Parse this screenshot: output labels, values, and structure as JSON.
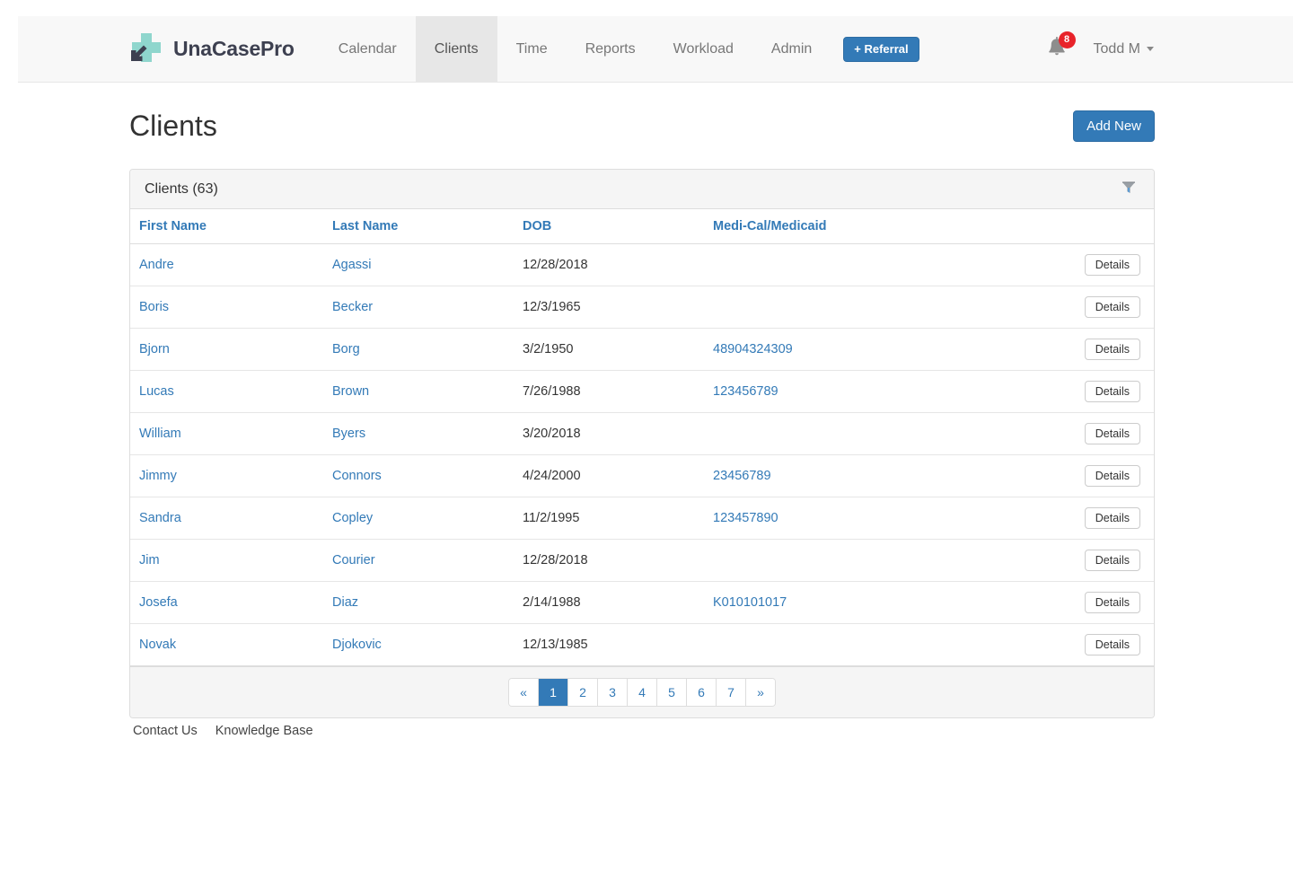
{
  "brand": {
    "name": "UnaCasePro",
    "logo_icon": "cross-arrow-logo",
    "logo_cross_color": "#8fd6cd",
    "logo_arrow_color": "#3d4050"
  },
  "nav": {
    "items": [
      {
        "label": "Calendar",
        "active": false
      },
      {
        "label": "Clients",
        "active": true
      },
      {
        "label": "Time",
        "active": false
      },
      {
        "label": "Reports",
        "active": false
      },
      {
        "label": "Workload",
        "active": false
      },
      {
        "label": "Admin",
        "active": false
      }
    ],
    "referral_button": "+ Referral",
    "notifications": {
      "icon": "bell-icon",
      "count": "8",
      "badge_color": "#e8232a"
    },
    "user": {
      "name": "Todd M",
      "caret_icon": "caret-down-icon"
    }
  },
  "page": {
    "title": "Clients",
    "add_new_button": "Add New",
    "accent_color": "#337ab7"
  },
  "panel": {
    "title": "Clients (63)",
    "filter_icon": "filter-funnel-icon"
  },
  "table": {
    "columns": [
      "First Name",
      "Last Name",
      "DOB",
      "Medi-Cal/Medicaid",
      ""
    ],
    "details_label": "Details",
    "rows": [
      {
        "first": "Andre",
        "last": "Agassi",
        "dob": "12/28/2018",
        "medical": ""
      },
      {
        "first": "Boris",
        "last": "Becker",
        "dob": "12/3/1965",
        "medical": ""
      },
      {
        "first": "Bjorn",
        "last": "Borg",
        "dob": "3/2/1950",
        "medical": "48904324309"
      },
      {
        "first": "Lucas",
        "last": "Brown",
        "dob": "7/26/1988",
        "medical": "123456789"
      },
      {
        "first": "William",
        "last": "Byers",
        "dob": "3/20/2018",
        "medical": ""
      },
      {
        "first": "Jimmy",
        "last": "Connors",
        "dob": "4/24/2000",
        "medical": "23456789"
      },
      {
        "first": "Sandra",
        "last": "Copley",
        "dob": "11/2/1995",
        "medical": "123457890"
      },
      {
        "first": "Jim",
        "last": "Courier",
        "dob": "12/28/2018",
        "medical": ""
      },
      {
        "first": "Josefa",
        "last": "Diaz",
        "dob": "2/14/1988",
        "medical": "K010101017"
      },
      {
        "first": "Novak",
        "last": "Djokovic",
        "dob": "12/13/1985",
        "medical": ""
      }
    ]
  },
  "pagination": {
    "prev": "«",
    "next": "»",
    "pages": [
      "1",
      "2",
      "3",
      "4",
      "5",
      "6",
      "7"
    ],
    "current": "1"
  },
  "footer": {
    "links": [
      "Contact Us",
      "Knowledge Base"
    ]
  }
}
